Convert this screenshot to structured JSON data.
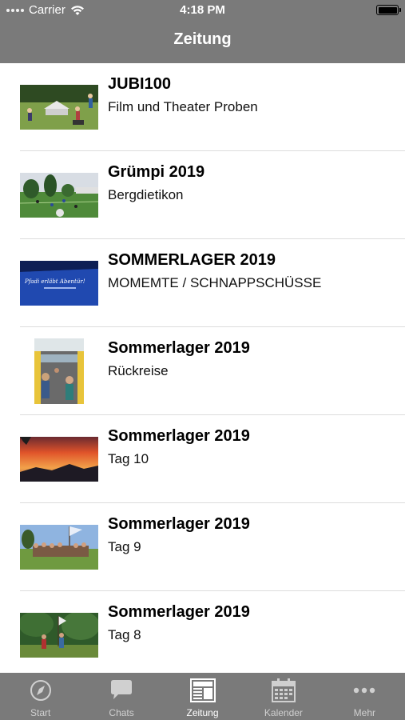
{
  "status": {
    "carrier": "Carrier",
    "time": "4:18 PM"
  },
  "nav": {
    "title": "Zeitung"
  },
  "articles": [
    {
      "title": "JUBI100",
      "subtitle": "Film und Theater Proben"
    },
    {
      "title": "Grümpi 2019",
      "subtitle": "Bergdietikon"
    },
    {
      "title": "SOMMERLAGER 2019",
      "subtitle": "MOMEMTE / SCHNAPPSCHÜSSE",
      "thumb_text": "Pfadi erläbt Abentür!"
    },
    {
      "title": "Sommerlager 2019",
      "subtitle": "Rückreise"
    },
    {
      "title": "Sommerlager 2019",
      "subtitle": "Tag 10"
    },
    {
      "title": "Sommerlager 2019",
      "subtitle": "Tag 9"
    },
    {
      "title": "Sommerlager 2019",
      "subtitle": "Tag 8"
    }
  ],
  "tabs": [
    {
      "label": "Start",
      "icon": "compass-icon"
    },
    {
      "label": "Chats",
      "icon": "chat-bubble-icon"
    },
    {
      "label": "Zeitung",
      "icon": "newspaper-icon",
      "active": true
    },
    {
      "label": "Kalender",
      "icon": "calendar-icon"
    },
    {
      "label": "Mehr",
      "icon": "more-dots-icon"
    }
  ],
  "colors": {
    "bar": "#7a7a7a",
    "tab_inactive": "#d0d0d0",
    "tab_active": "#ffffff",
    "separator": "#dcdcdc"
  }
}
